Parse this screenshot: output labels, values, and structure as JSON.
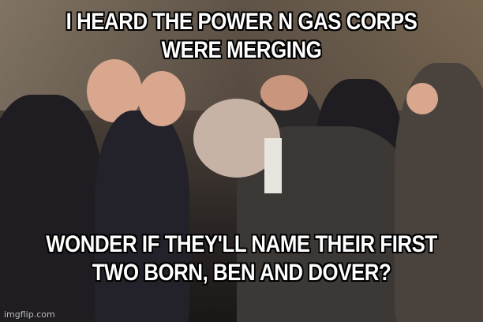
{
  "meme": {
    "top_text": "I HEARD THE POWER N GAS CORPS WERE MERGING",
    "bottom_text": "WONDER IF THEY'LL NAME THEIR FIRST TWO BORN, BEN AND DOVER?",
    "watermark": "imgflip.com"
  }
}
